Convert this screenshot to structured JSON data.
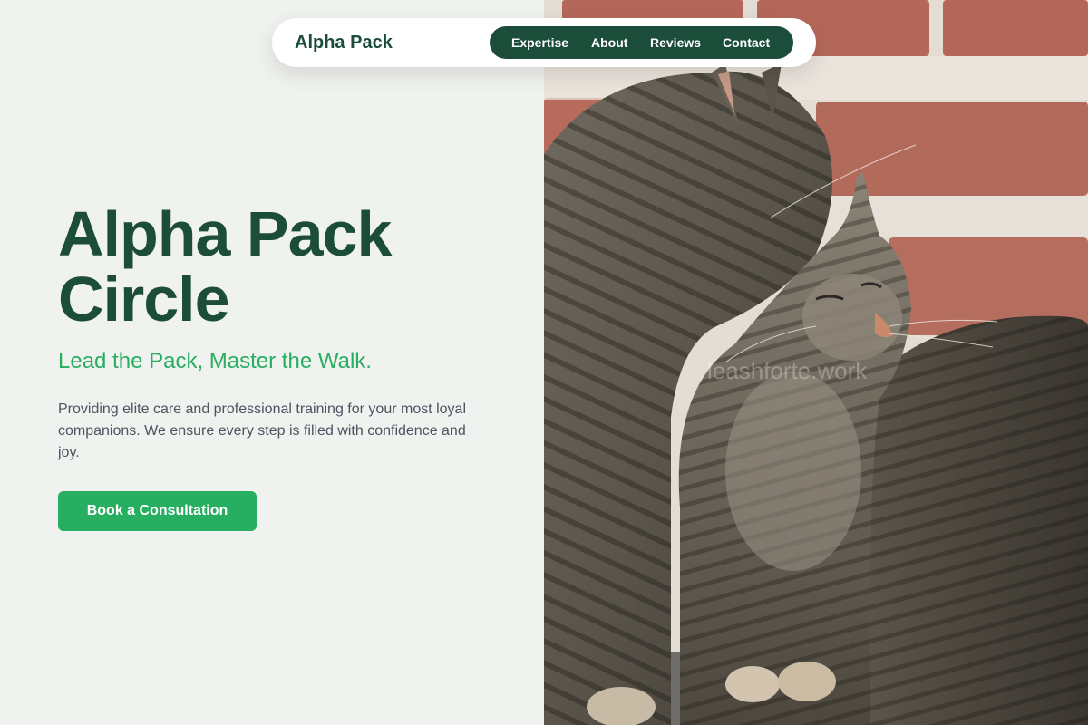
{
  "nav": {
    "brand": "Alpha Pack",
    "links": [
      {
        "label": "Expertise"
      },
      {
        "label": "About"
      },
      {
        "label": "Reviews"
      },
      {
        "label": "Contact"
      }
    ]
  },
  "hero": {
    "title_line1": "Alpha Pack",
    "title_line2": "Circle",
    "tagline": "Lead the Pack, Master the Walk.",
    "description": "Providing elite care and professional training for your most loyal companions. We ensure every step is filled with confidence and joy.",
    "cta_label": "Book a Consultation"
  },
  "photo": {
    "subject": "two tabby cats nuzzling in front of a brick wall",
    "watermark": "leashforte.work"
  },
  "colors": {
    "brand_dark_green": "#1b4d3a",
    "accent_green": "#27ae60",
    "background": "#f0f2ef",
    "body_text": "#4a5560"
  }
}
